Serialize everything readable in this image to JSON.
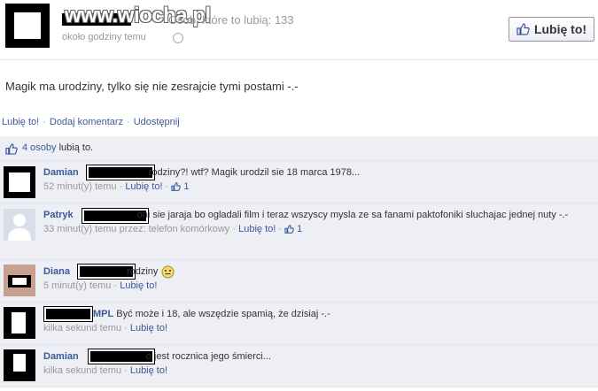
{
  "header": {
    "watermark": "www.wiocha.pl",
    "likes_count": "Osób, które to lubią: 133",
    "post_time": "około godziny temu",
    "like_button_label": "Lubię to!"
  },
  "post": {
    "text": "Magik ma urodziny, tylko się nie zesrajcie tymi postami -.-"
  },
  "actions": {
    "like": "Lubię to!",
    "comment": "Dodaj komentarz",
    "share": "Udostępnij",
    "separator": "·"
  },
  "likes_summary": {
    "count_link": "4 osoby",
    "suffix": " lubią to."
  },
  "comments": [
    {
      "name": "Damian",
      "text": "rodziny?! wtf? Magik urodzil sie 18 marca 1978...",
      "time": "52 minut(y) temu",
      "like": "Lubię to!",
      "likes": "1",
      "via": ""
    },
    {
      "name": "Patryk",
      "text": "oni sie jaraja bo ogladali film i teraz wszyscy mysla ze sa fanami paktofoniki sluchajac jednej nuty -.-",
      "time": "33 minut(y) temu przez: telefon komórkowy",
      "like": "Lubię to!",
      "likes": "1",
      "via": ""
    },
    {
      "name": "Diana",
      "text": "rodziny",
      "time": "5 minut(y) temu",
      "like": "Lubię to!",
      "likes": "",
      "via": ""
    },
    {
      "name": "MPL",
      "text": "Być może i 18, ale wszędzie spamią, że dzisiaj -.-",
      "time": "kilka sekund temu",
      "like": "Lubię to!",
      "likes": "",
      "via": ""
    },
    {
      "name": "Damian",
      "text": "o jest rocznica jego śmierci...",
      "time": "kilka sekund temu",
      "like": "Lubię to!",
      "likes": "",
      "via": ""
    }
  ],
  "colors": {
    "link": "#3b5998",
    "comment_bg": "#edeff4",
    "muted": "#999999"
  }
}
